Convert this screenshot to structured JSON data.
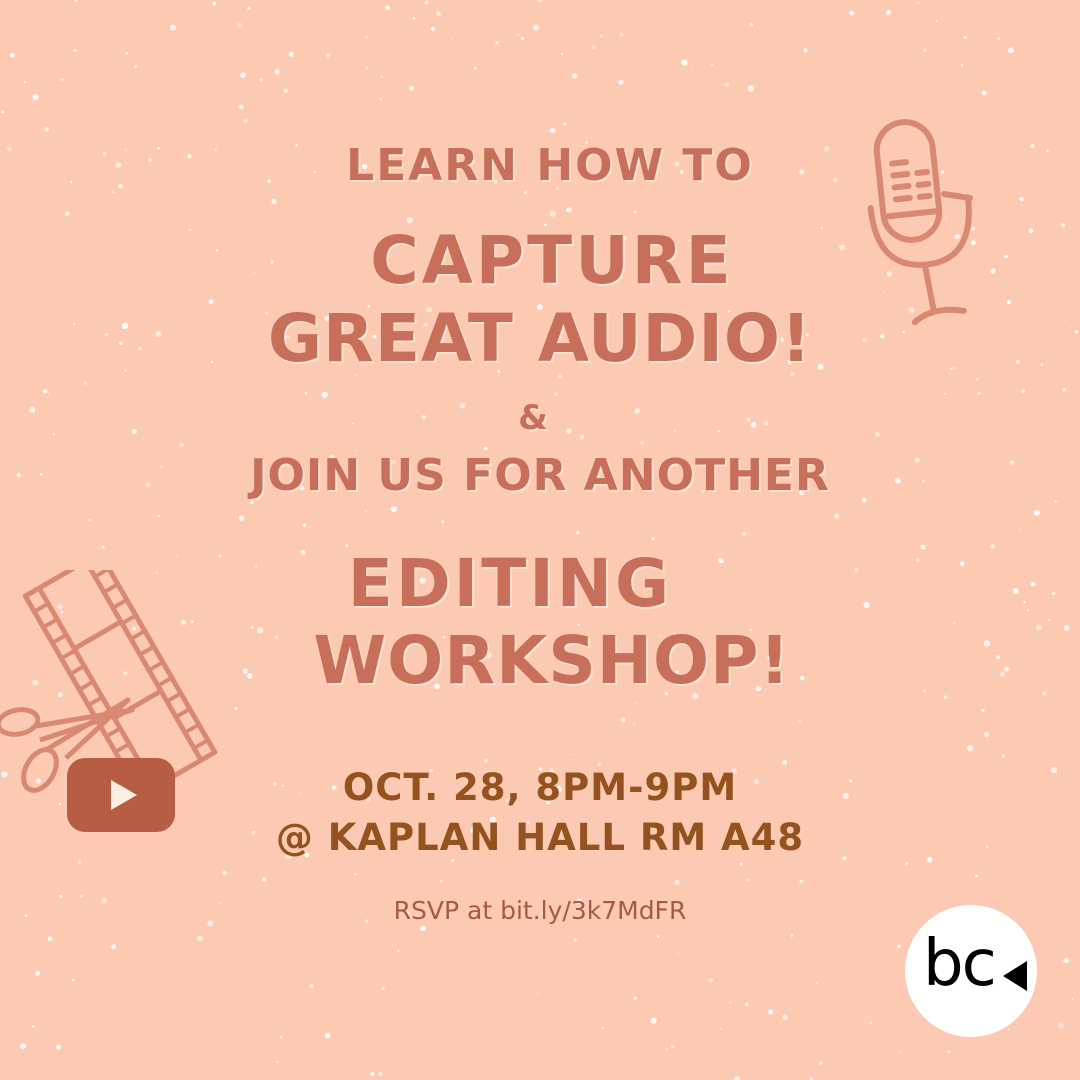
{
  "poster": {
    "headline_intro": "LEARN HOW TO",
    "headline_1": "CAPTURE",
    "headline_2": "GREAT AUDIO!",
    "ampersand": "&",
    "subline": "JOIN US FOR ANOTHER",
    "headline_3": "EDITING",
    "headline_4": "WORKSHOP!",
    "date_time": "OCT. 28, 8PM-9PM",
    "location": "@ KAPLAN HALL RM A48",
    "rsvp": "RSVP at bit.ly/3k7MdFR",
    "logo_text": "bc"
  },
  "icons": [
    "microphone-icon",
    "film-strip-icon",
    "scissors-icon",
    "play-button-icon",
    "logo-arrow-icon"
  ],
  "colors": {
    "background": "#fcc9b3",
    "headline": "#c86f5c",
    "details": "#94521f",
    "play_button": "#b65d44",
    "logo_bg": "#ffffff"
  }
}
